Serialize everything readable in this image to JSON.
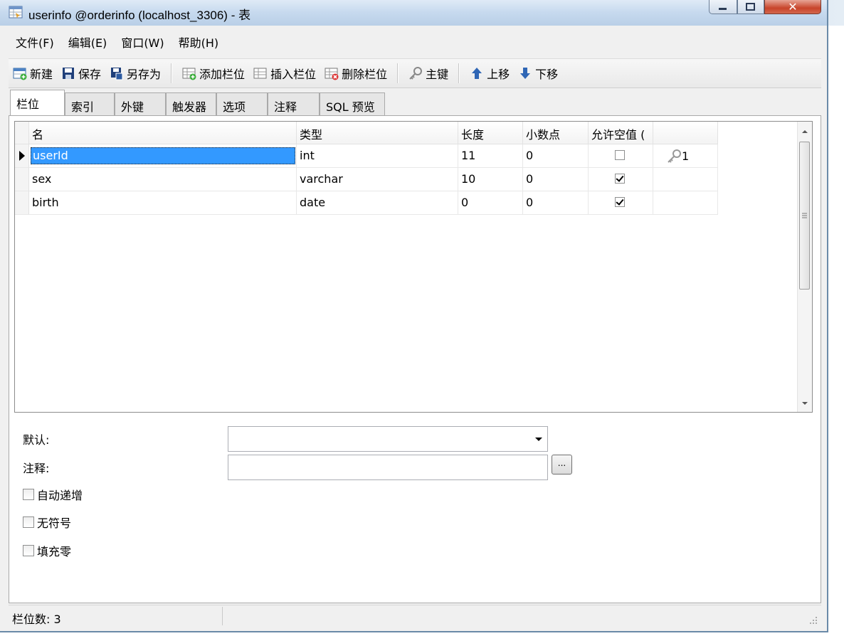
{
  "window": {
    "title": "userinfo @orderinfo (localhost_3306) - 表",
    "controls": {
      "minimize": "–",
      "maximize": "□",
      "close": "✕"
    }
  },
  "menu": [
    "文件(F)",
    "编辑(E)",
    "窗口(W)",
    "帮助(H)"
  ],
  "toolbar": {
    "new": "新建",
    "save": "保存",
    "save_as": "另存为",
    "add_field": "添加栏位",
    "insert_field": "插入栏位",
    "delete_field": "删除栏位",
    "primary_key": "主键",
    "move_up": "上移",
    "move_down": "下移"
  },
  "tabs": [
    "栏位",
    "索引",
    "外键",
    "触发器",
    "选项",
    "注释",
    "SQL 预览"
  ],
  "grid": {
    "headers": [
      "名",
      "类型",
      "长度",
      "小数点",
      "允许空值 (",
      ""
    ],
    "rows": [
      {
        "name": "userId",
        "type": "int",
        "length": "11",
        "decimals": "0",
        "allow_null": false,
        "key": "1"
      },
      {
        "name": "sex",
        "type": "varchar",
        "length": "10",
        "decimals": "0",
        "allow_null": true,
        "key": ""
      },
      {
        "name": "birth",
        "type": "date",
        "length": "0",
        "decimals": "0",
        "allow_null": true,
        "key": ""
      }
    ]
  },
  "properties": {
    "default_label": "默认:",
    "comment_label": "注释:",
    "comment_button": "...",
    "options": [
      {
        "label": "自动递增",
        "checked": false
      },
      {
        "label": "无符号",
        "checked": false
      },
      {
        "label": "填充零",
        "checked": false
      }
    ]
  },
  "status": {
    "field_count": "栏位数: 3"
  }
}
